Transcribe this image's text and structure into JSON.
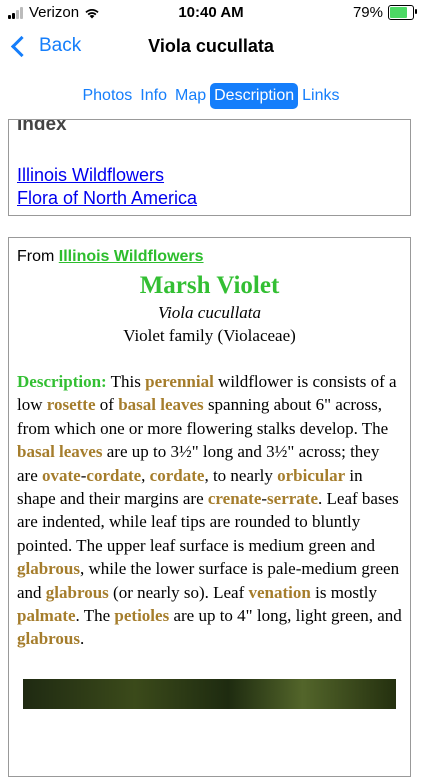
{
  "status_bar": {
    "carrier": "Verizon",
    "time": "10:40 AM",
    "battery_percent": "79%",
    "battery_level": 0.79,
    "battery_fill_color": "#4cd964"
  },
  "nav": {
    "back_label": "Back",
    "title": "Viola cucullata"
  },
  "tabs": [
    {
      "label": "Photos"
    },
    {
      "label": "Info"
    },
    {
      "label": "Map"
    },
    {
      "label": "Description",
      "active": true
    },
    {
      "label": "Links"
    }
  ],
  "index_box": {
    "heading": "Index",
    "links": [
      "Illinois Wildflowers",
      "Flora of North America"
    ]
  },
  "main": {
    "from_prefix": "From ",
    "from_link": "Illinois Wildflowers",
    "common_name": "Marsh Violet",
    "scientific_name": "Viola cucullata",
    "family": "Violet family (Violaceae)",
    "description_label": "Description:",
    "description_parts": [
      {
        "t": " This "
      },
      {
        "t": "perennial",
        "term": true
      },
      {
        "t": " wildflower is consists of a low "
      },
      {
        "t": "rosette",
        "term": true
      },
      {
        "t": " of "
      },
      {
        "t": "basal leaves",
        "term": true
      },
      {
        "t": " spanning about 6\" across, from which one or more flowering stalks develop. The "
      },
      {
        "t": "basal leaves",
        "term": true
      },
      {
        "t": " are up to 3½\" long and 3½\" across; they are "
      },
      {
        "t": "ovate",
        "term": true
      },
      {
        "t": "-"
      },
      {
        "t": "cordate",
        "term": true
      },
      {
        "t": ", "
      },
      {
        "t": "cordate",
        "term": true
      },
      {
        "t": ", to nearly "
      },
      {
        "t": "orbicular",
        "term": true
      },
      {
        "t": " in shape and their margins are "
      },
      {
        "t": "crenate",
        "term": true
      },
      {
        "t": "-"
      },
      {
        "t": "serrate",
        "term": true
      },
      {
        "t": ". Leaf bases are indented, while leaf tips are rounded to bluntly pointed. The upper leaf surface is medium green and "
      },
      {
        "t": "glabrous",
        "term": true
      },
      {
        "t": ", while the lower surface is pale-medium green and "
      },
      {
        "t": "glabrous",
        "term": true
      },
      {
        "t": " (or nearly so). Leaf "
      },
      {
        "t": "venation",
        "term": true
      },
      {
        "t": " is mostly "
      },
      {
        "t": "palmate",
        "term": true
      },
      {
        "t": ". The "
      },
      {
        "t": "petioles",
        "term": true
      },
      {
        "t": " are up to 4\" long, light green, and "
      },
      {
        "t": "glabrous",
        "term": true
      },
      {
        "t": "."
      }
    ]
  },
  "colors": {
    "accent_blue": "#157efb",
    "title_green": "#33bf33",
    "term_brown": "#a57d2c",
    "link_blue": "#0000ee"
  }
}
